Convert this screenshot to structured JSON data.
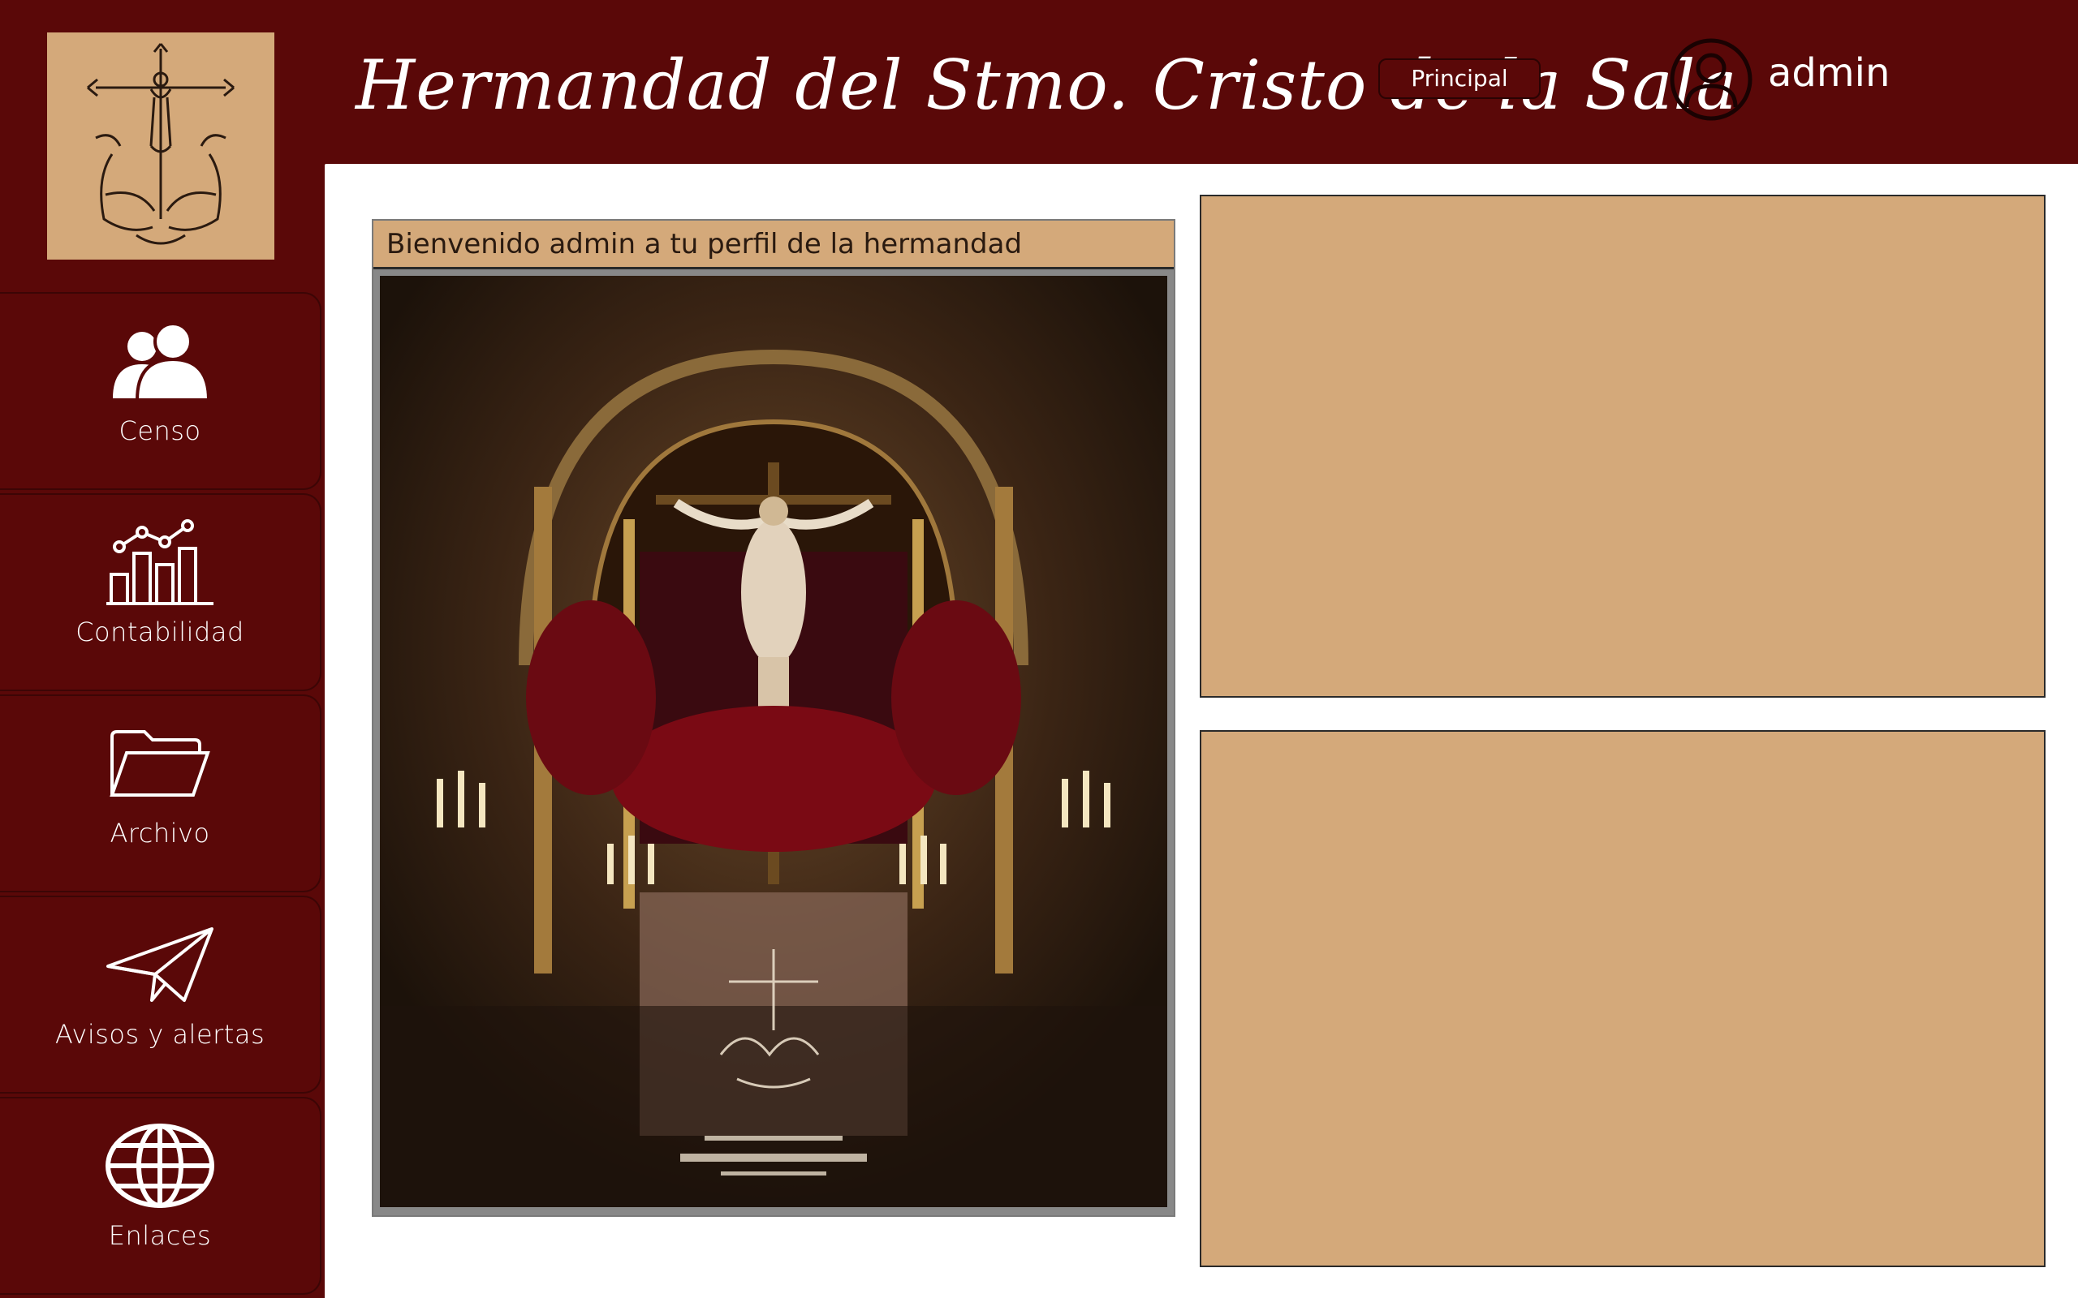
{
  "header": {
    "title": "Hermandad del Stmo. Cristo de la Sala",
    "principal_label": "Principal",
    "user_name": "admin"
  },
  "sidebar": {
    "items": [
      {
        "label": "Censo",
        "icon": "users-icon"
      },
      {
        "label": "Contabilidad",
        "icon": "chart-icon"
      },
      {
        "label": "Archivo",
        "icon": "folder-icon"
      },
      {
        "label": "Avisos y alertas",
        "icon": "paper-plane-icon"
      },
      {
        "label": "Enlaces",
        "icon": "globe-icon"
      }
    ]
  },
  "main": {
    "welcome_text": "Bienvenido admin a tu perfil de la hermandad"
  },
  "colors": {
    "primary": "#5a0808",
    "accent": "#d4a97a",
    "text_light": "#ffffff"
  }
}
